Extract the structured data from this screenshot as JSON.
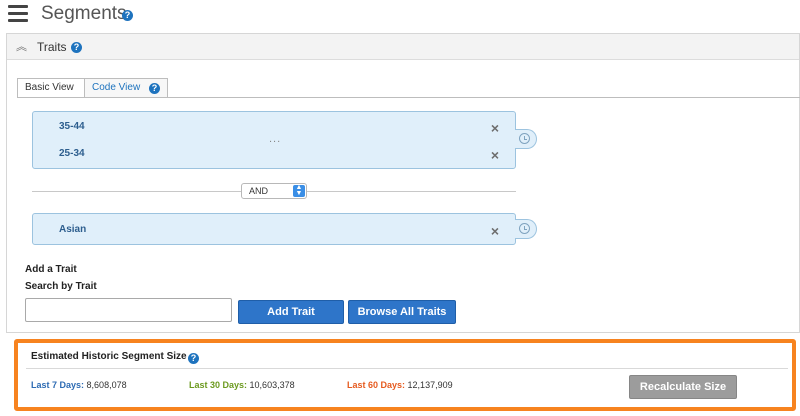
{
  "header": {
    "title": "Segments",
    "help_icon": "help-icon"
  },
  "traits_panel": {
    "title": "Traits",
    "collapse_icon": "collapse-chevron-up-icon",
    "tabs": [
      {
        "label": "Basic View",
        "active": true
      },
      {
        "label": "Code View",
        "active": false
      }
    ],
    "groups": [
      {
        "traits": [
          "35-44",
          "25-34"
        ],
        "has_ellipsis": true,
        "ellipsis": "..."
      },
      {
        "traits": [
          "Asian"
        ],
        "has_ellipsis": false
      }
    ],
    "operator": "AND",
    "remove_icon": "×",
    "add_trait_heading": "Add a Trait",
    "search_label": "Search by Trait",
    "search_value": "",
    "add_button": "Add Trait",
    "browse_button": "Browse All Traits"
  },
  "estimated_size": {
    "title": "Estimated Historic Segment Size",
    "stats": [
      {
        "label": "Last 7 Days:",
        "value": "8,608,078",
        "color": "#2d6bb3"
      },
      {
        "label": "Last 30 Days:",
        "value": "10,603,378",
        "color": "#6c9a1f"
      },
      {
        "label": "Last 60 Days:",
        "value": "12,137,909",
        "color": "#e65a1e"
      }
    ],
    "recalculate_button": "Recalculate Size",
    "highlight_color": "#f7831f"
  }
}
